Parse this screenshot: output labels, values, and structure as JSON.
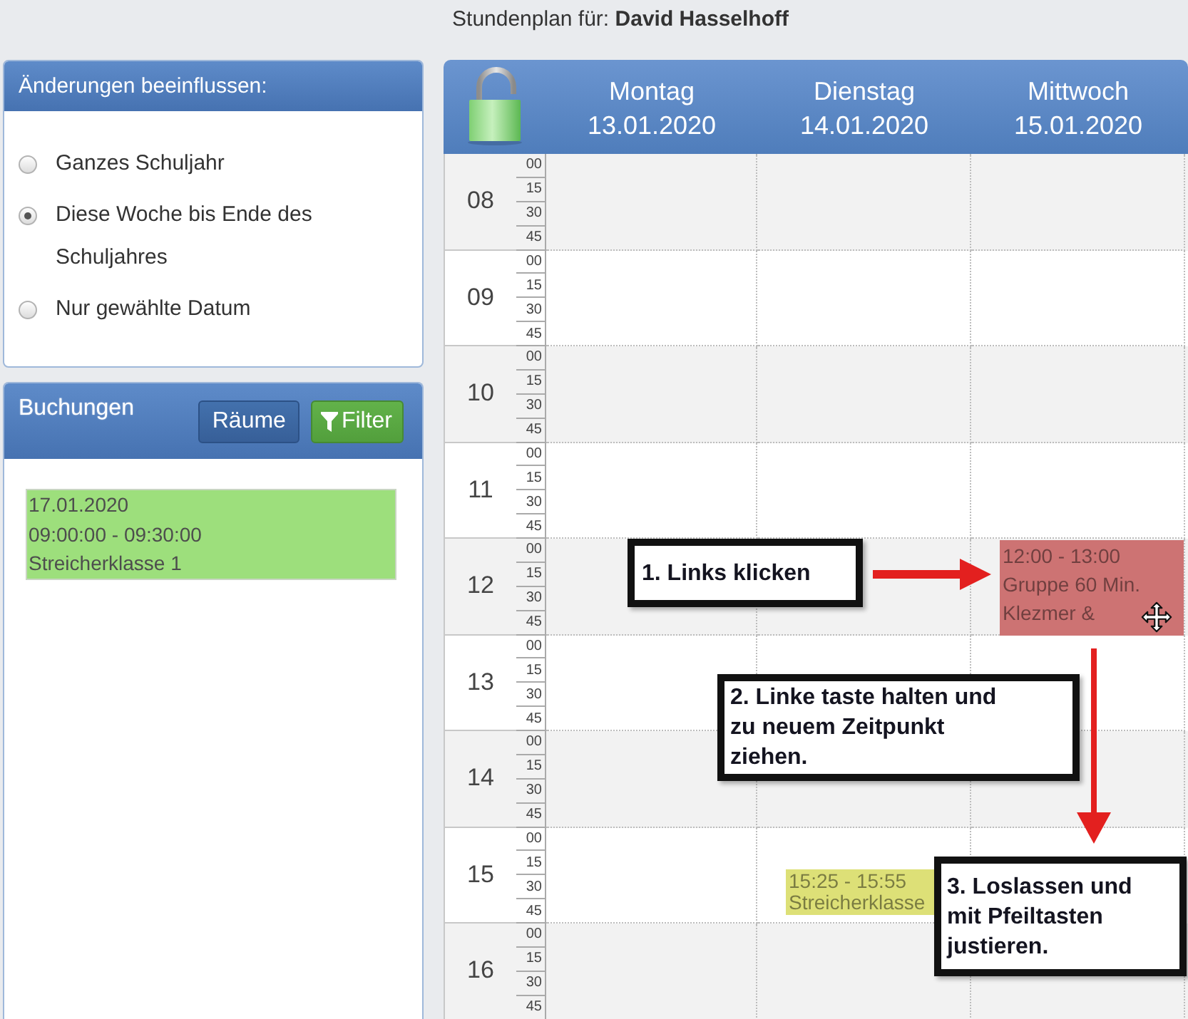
{
  "page_title": "Stundenplan für: **David Hasselhoff**",
  "scope_panel": {
    "title": "Änderungen beeinflussen:",
    "options": [
      {
        "label": "Ganzes Schuljahr",
        "selected": false
      },
      {
        "label": "Diese Woche bis Ende des Schuljahres",
        "selected": true
      },
      {
        "label": "Nur gewählte Datum",
        "selected": false
      }
    ]
  },
  "bookings_panel": {
    "title": "Buchungen",
    "buttons": [
      {
        "label": "Räume",
        "kind": "plain"
      },
      {
        "label": "Filter",
        "kind": "filter"
      }
    ],
    "bookings": [
      {
        "date": "17.01.2020",
        "time": "09:00:00 - 09:30:00",
        "title": "Streicherklasse 1"
      }
    ]
  },
  "calendar": {
    "locked": false,
    "days": [
      {
        "name": "Montag",
        "date": "13.01.2020"
      },
      {
        "name": "Dienstag",
        "date": "14.01.2020",
        "events": [
          {
            "time": "15:25 - 15:55",
            "title": "Streicherklasse",
            "color": "#dde077",
            "grabbed": false
          }
        ]
      },
      {
        "name": "Mittwoch",
        "date": "15.01.2020",
        "events": [
          {
            "time": "12:00 - 13:00",
            "title": "Gruppe 60 Min. Klezmer &",
            "color": "#cd7373",
            "grabbed": true
          }
        ]
      }
    ],
    "hours": [
      {
        "label": "08",
        "minutes": [
          "00",
          "15",
          "30",
          "45"
        ]
      },
      {
        "label": "09",
        "minutes": [
          "00",
          "15",
          "30",
          "45"
        ]
      },
      {
        "label": "10",
        "minutes": [
          "00",
          "15",
          "30",
          "45"
        ]
      },
      {
        "label": "11",
        "minutes": [
          "00",
          "15",
          "30",
          "45"
        ]
      },
      {
        "label": "12",
        "minutes": [
          "00",
          "15",
          "30",
          "45"
        ]
      },
      {
        "label": "13",
        "minutes": [
          "00",
          "15",
          "30",
          "45"
        ]
      },
      {
        "label": "14",
        "minutes": [
          "00",
          "15",
          "30",
          "45"
        ]
      },
      {
        "label": "15",
        "minutes": [
          "00",
          "15",
          "30",
          "45"
        ]
      },
      {
        "label": "16",
        "minutes": [
          "00",
          "15",
          "30",
          "45"
        ]
      }
    ]
  },
  "annotations": [
    {
      "text": "1. Links klicken",
      "kind": "right"
    },
    {
      "text": "2. Linke taste halten und\nzu neuem Zeitpunkt\nziehen.",
      "kind": "down"
    },
    {
      "text": "3. Loslassen und\nmit Pfeiltasten\njustieren.",
      "kind": "plain"
    }
  ]
}
